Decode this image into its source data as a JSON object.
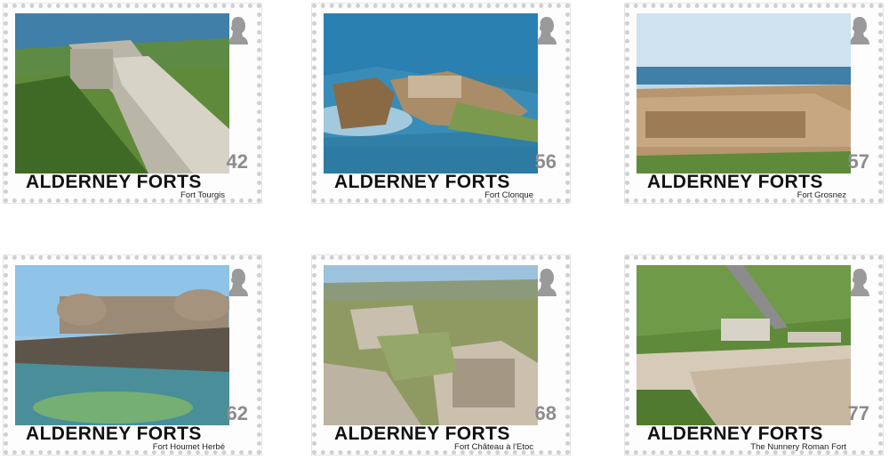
{
  "series_title": "ALDERNEY FORTS",
  "stamps": [
    {
      "fort_name": "Fort Tourgis",
      "value": "42",
      "icon": "queen-head-icon"
    },
    {
      "fort_name": "Fort Clonque",
      "value": "56",
      "icon": "queen-head-icon"
    },
    {
      "fort_name": "Fort Grosnez",
      "value": "57",
      "icon": "queen-head-icon"
    },
    {
      "fort_name": "Fort Houmet Herbé",
      "value": "62",
      "icon": "queen-head-icon"
    },
    {
      "fort_name": "Fort Château à l'Etoc",
      "value": "68",
      "icon": "queen-head-icon"
    },
    {
      "fort_name": "The Nunnery Roman Fort",
      "value": "77",
      "icon": "queen-head-icon"
    }
  ],
  "colors": {
    "value_text": "#8c8c8c",
    "title_text": "#111111",
    "perforation": "#d0d0d0"
  }
}
